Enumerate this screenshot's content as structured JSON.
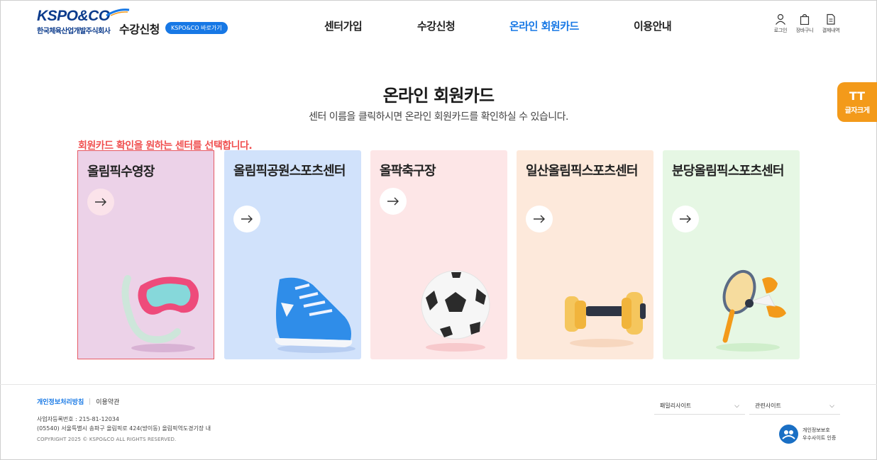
{
  "header": {
    "logo_text": "KSPO&CO",
    "logo_subtext": "한국체육산업개발주식회사",
    "site_title": "수강신청",
    "site_link": "KSPO&CO 바로가기",
    "nav": [
      {
        "label": "센터가입",
        "active": false
      },
      {
        "label": "수강신청",
        "active": false
      },
      {
        "label": "온라인 회원카드",
        "active": true
      },
      {
        "label": "이용안내",
        "active": false
      }
    ],
    "utility": [
      {
        "label": "로그인",
        "icon": "user-icon"
      },
      {
        "label": "장바구니",
        "icon": "cart-icon"
      },
      {
        "label": "결제내역",
        "icon": "receipt-icon"
      }
    ]
  },
  "main": {
    "title": "온라인 회원카드",
    "description": "센터 이름을 클릭하시면 온라인 회원카드를 확인하실 수 있습니다.",
    "instruction": "회원카드 확인을 원하는 센터를 선택합니다.",
    "font_size_button": {
      "icon": "TT",
      "label": "글자크게"
    },
    "centers": [
      {
        "name": "올림픽수영장",
        "illustration": "snorkel-mask-icon",
        "bg": "#ecd2e8",
        "selected": true
      },
      {
        "name": "올림픽공원스포츠센터",
        "illustration": "sneaker-icon",
        "bg": "#d1e2fb",
        "selected": false
      },
      {
        "name": "올팍축구장",
        "illustration": "soccer-ball-icon",
        "bg": "#fde6e7",
        "selected": false
      },
      {
        "name": "일산올림픽스포츠센터",
        "illustration": "dumbbell-icon",
        "bg": "#fde9db",
        "selected": false
      },
      {
        "name": "분당올림픽스포츠센터",
        "illustration": "badminton-racket-icon",
        "bg": "#e6f7e4",
        "selected": false
      }
    ]
  },
  "footer": {
    "links": [
      "개인정보처리방침",
      "이용약관"
    ],
    "business_number": "사업자등록번호 : 215-81-12034",
    "address": "(05540) 서울특별시 송파구 올림픽로 424(방이동) 올림픽역도경기장 내",
    "copyright": "COPYRIGHT 2025 © KSPO&CO ALL RIGHTS RESERVED.",
    "family_site": "패밀리사이트",
    "related_site": "관련사이트",
    "certification": [
      "개인정보보호",
      "우수사이트 인증"
    ]
  },
  "colors": {
    "accent": "#1778e5",
    "instruction": "#f05050",
    "font_button": "#f39a1a",
    "logo": "#0b3b8c"
  }
}
